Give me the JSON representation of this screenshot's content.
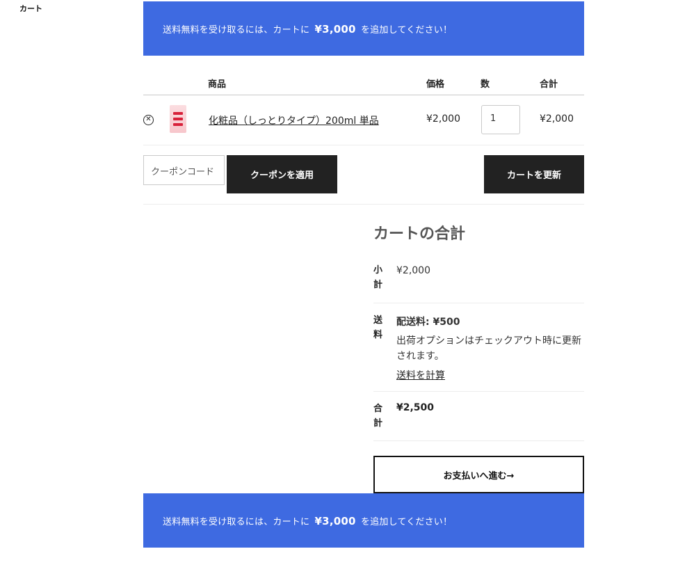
{
  "page": {
    "title": "カート"
  },
  "banner": {
    "before": "送料無料を受け取るには、カートに",
    "amount": "¥3,000",
    "after": "を追加してください！"
  },
  "table": {
    "headers": {
      "product": "商品",
      "price": "価格",
      "quantity": "数",
      "subtotal": "合計"
    },
    "rows": [
      {
        "remove_icon": "remove-circle-x-icon",
        "thumbnail": "cosmetic-bottle-thumbnail",
        "name": "化粧品（しっとりタイプ）200ml 単品",
        "price": "¥2,000",
        "quantity": "1",
        "total": "¥2,000"
      }
    ]
  },
  "coupon": {
    "placeholder": "クーポンコード",
    "apply_label": "クーポンを適用"
  },
  "update_cart_label": "カートを更新",
  "totals": {
    "title": "カートの合計",
    "subtotal_label": "小計",
    "subtotal_value": "¥2,000",
    "shipping_label": "送料",
    "shipping_value": "配送料: ¥500",
    "shipping_note": "出荷オプションはチェックアウト時に更新されます。",
    "shipping_calc_link": "送料を計算",
    "total_label": "合計",
    "total_value": "¥2,500"
  },
  "checkout_label": "お支払いへ進む→",
  "colors": {
    "banner": "#3e6ae1",
    "button_dark": "#222222"
  }
}
